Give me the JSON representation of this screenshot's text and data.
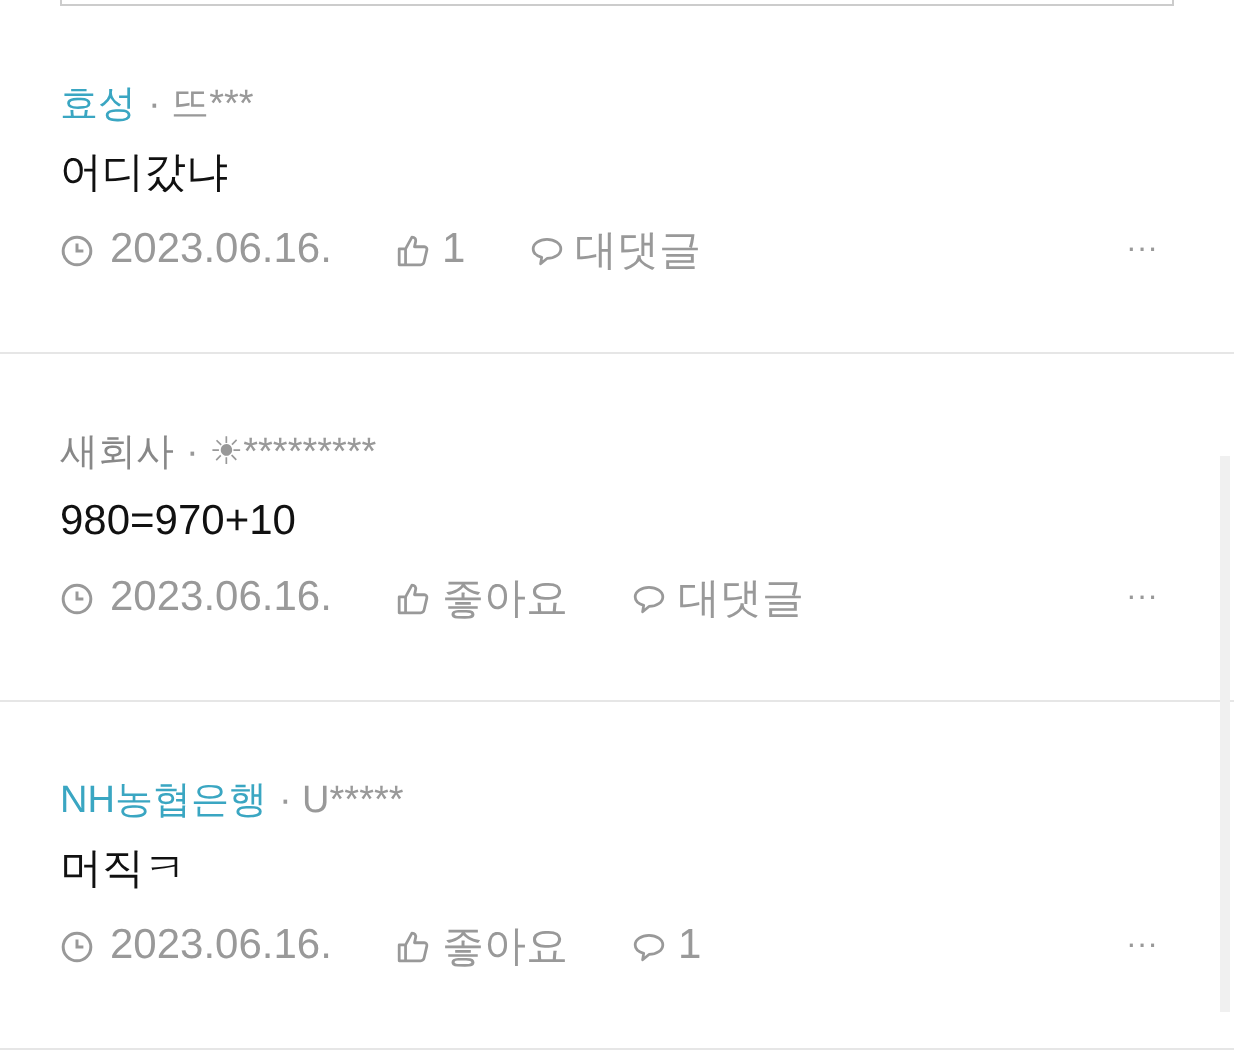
{
  "comments": [
    {
      "company": "효성",
      "company_highlighted": true,
      "separator": "·",
      "user": "뜨***",
      "text": "어디갔냐",
      "date": "2023.06.16.",
      "likes": "1",
      "replies": "대댓글",
      "more": "···"
    },
    {
      "company": "새회사",
      "company_highlighted": false,
      "separator": "·",
      "user": "☀*********",
      "text": "980=970+10",
      "date": "2023.06.16.",
      "likes": "좋아요",
      "replies": "대댓글",
      "more": "···"
    },
    {
      "company": "NH농협은행",
      "company_highlighted": true,
      "separator": "·",
      "user": "U*****",
      "text": "머직ㅋ",
      "date": "2023.06.16.",
      "likes": "좋아요",
      "replies": "1",
      "more": "···"
    }
  ]
}
